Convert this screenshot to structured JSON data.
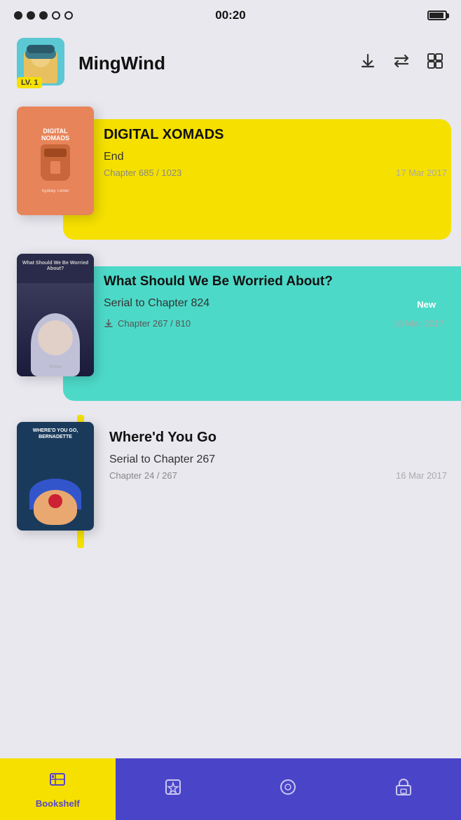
{
  "statusBar": {
    "time": "00:20"
  },
  "header": {
    "username": "MingWind",
    "level": "LV. 1",
    "avatarEmoji": "🧢"
  },
  "books": [
    {
      "id": "book1",
      "title": "DIGITAL XOMADS",
      "status": "End",
      "chapterInfo": "Chapter 685 / 1023",
      "date": "17 Mar 2017",
      "cardColor": "#f5e000",
      "newBadge": false
    },
    {
      "id": "book2",
      "title": "What Should We Be Worried About?",
      "status": "Serial to Chapter 824",
      "chapterInfo": "Chapter 267 / 810",
      "date": "16 Mar 2017",
      "cardColor": "#4dd9c8",
      "newBadge": true,
      "newLabel": "New"
    },
    {
      "id": "book3",
      "title": "Where'd You Go",
      "status": "Serial to Chapter 267",
      "chapterInfo": "Chapter 24 / 267",
      "date": "16 Mar 2017",
      "cardColor": "#f5e000",
      "newBadge": false
    }
  ],
  "bottomNav": [
    {
      "id": "bookshelf",
      "label": "Bookshelf",
      "active": true
    },
    {
      "id": "favorites",
      "label": "",
      "active": false
    },
    {
      "id": "discover",
      "label": "",
      "active": false
    },
    {
      "id": "store",
      "label": "",
      "active": false
    }
  ]
}
